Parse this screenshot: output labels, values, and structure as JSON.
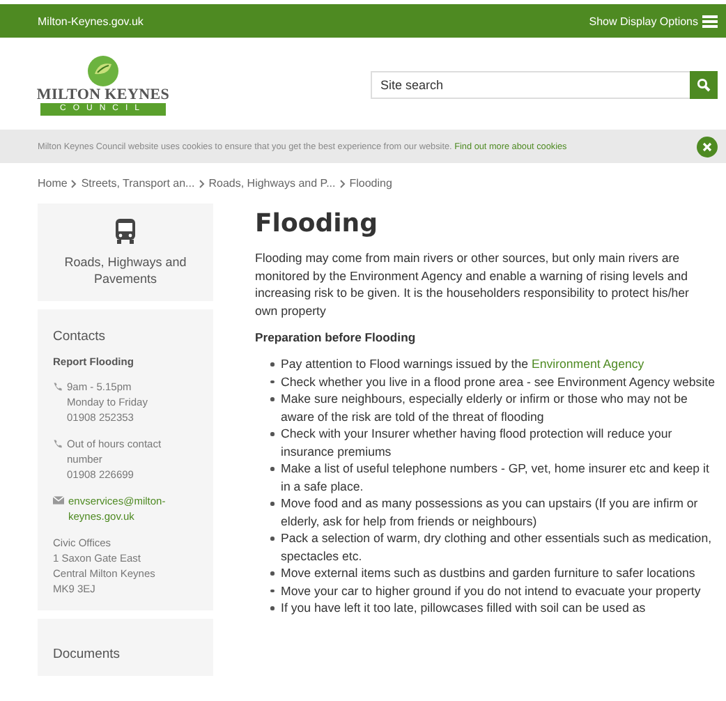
{
  "top_bar": {
    "site": "Milton-Keynes.gov.uk",
    "display_options": "Show Display Options"
  },
  "header": {
    "logo": {
      "name": "MILTON KEYNES",
      "subtitle": "COUNCIL"
    },
    "search": {
      "placeholder": "Site search"
    }
  },
  "cookie_notice": {
    "text": "Milton Keynes Council website uses cookies to ensure that you get the best experience from our website.",
    "link": "Find out more about cookies"
  },
  "breadcrumb": [
    "Home",
    "Streets, Transport an...",
    "Roads, Highways and P...",
    "Flooding"
  ],
  "sidebar": {
    "section_title": "Roads, Highways and Pavements",
    "contacts_title": "Contacts",
    "contact_name": "Report Flooding",
    "entries": [
      {
        "kind": "phone",
        "lines": [
          "9am - 5.15pm",
          "Monday to Friday",
          "01908 252353"
        ]
      },
      {
        "kind": "phone",
        "lines": [
          "Out of hours contact number",
          "01908 226699"
        ]
      },
      {
        "kind": "email",
        "lines": [
          "envservices@milton-keynes.gov.uk"
        ]
      }
    ],
    "address": [
      "Civic Offices",
      "1 Saxon Gate East",
      "Central Milton Keynes",
      "MK9 3EJ"
    ],
    "documents_title": "Documents"
  },
  "main": {
    "title": "Flooding",
    "intro": "Flooding may come from main rivers or other sources, but only main rivers are monitored by the Environment Agency and enable a warning of rising levels and increasing risk to be given. It is the householders responsibility to protect his/her own property",
    "subheading": "Preparation before Flooding",
    "items": [
      {
        "text": "Pay attention to Flood warnings issued by the ",
        "link": "Environment Agency"
      },
      {
        "text": "Check whether you live in a flood prone area - see Environment Agency website"
      },
      {
        "text": "Make sure neighbours, especially elderly or infirm or those who may not be aware of the risk are told of the threat of flooding"
      },
      {
        "text": "Check with your Insurer whether having flood protection will reduce your insurance premiums"
      },
      {
        "text": "Make a list of useful telephone numbers - GP, vet, home insurer etc and keep it in a safe place."
      },
      {
        "text": "Move food and as many possessions as you can upstairs (If you are infirm or elderly, ask for help from friends or neighbours)"
      },
      {
        "text": "Pack a selection of warm, dry clothing and other essentials such as medication, spectacles etc."
      },
      {
        "text": "Move external items such as dustbins and garden furniture to safer locations"
      },
      {
        "text": "Move your car to higher ground if you do not intend to evacuate your property"
      },
      {
        "text": "If you have left it too late, pillowcases filled with soil can be used as"
      }
    ]
  }
}
